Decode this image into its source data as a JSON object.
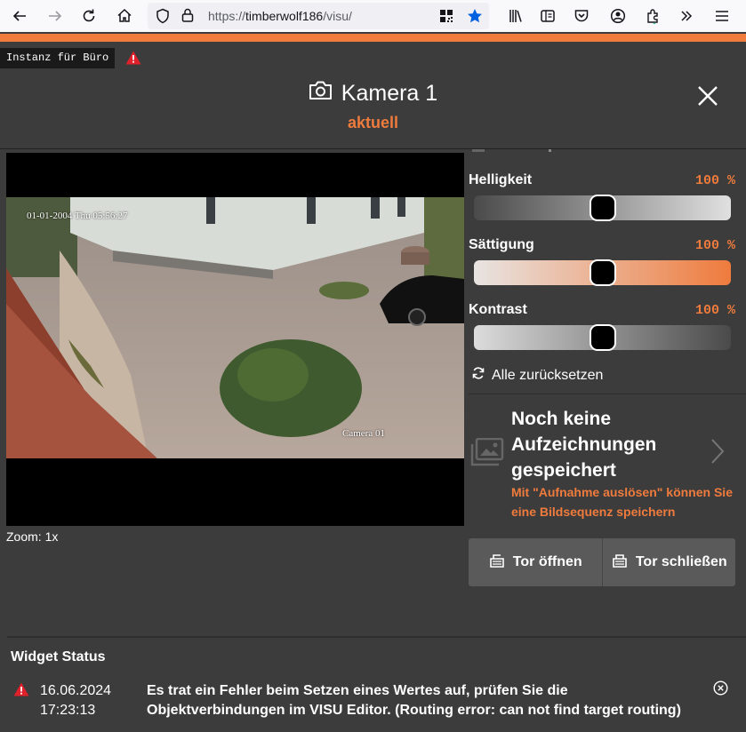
{
  "browser": {
    "url_scheme": "https://",
    "url_host": "timberwolf186",
    "url_path": "/visu/"
  },
  "instance": {
    "label": "Instanz für Büro"
  },
  "header": {
    "title": "Kamera 1",
    "subtitle": "aktuell"
  },
  "video": {
    "overlay_timestamp": "01-01-2004 Thu 05:56:27",
    "overlay_camera_name": "Camera 01",
    "zoom_label": "Zoom: 1x"
  },
  "adjustments": {
    "brightness": {
      "label": "Helligkeit",
      "value_text": "100 %",
      "level": 0.5
    },
    "saturation": {
      "label": "Sättigung",
      "value_text": "100 %",
      "level": 0.5
    },
    "contrast": {
      "label": "Kontrast",
      "value_text": "100 %",
      "level": 0.5
    },
    "reset_label": "Alle zurücksetzen"
  },
  "recordings": {
    "title": "Noch keine Aufzeichnungen gespeichert",
    "hint": "Mit \"Aufnahme auslösen\" können Sie eine Bildsequenz speichern"
  },
  "actions": {
    "open_gate": "Tor öffnen",
    "close_gate": "Tor schließen"
  },
  "widget_status": {
    "title": "Widget Status",
    "entries": [
      {
        "date": "16.06.2024",
        "time": "17:23:13",
        "message": "Es trat ein Fehler beim Setzen eines Wertes auf, prüfen Sie die Objektverbindungen im VISU Editor. (Routing error: can not find target routing)"
      }
    ]
  },
  "colors": {
    "accent": "#ef7b3d",
    "background": "#3c3c3c",
    "warning": "#e0202a"
  }
}
